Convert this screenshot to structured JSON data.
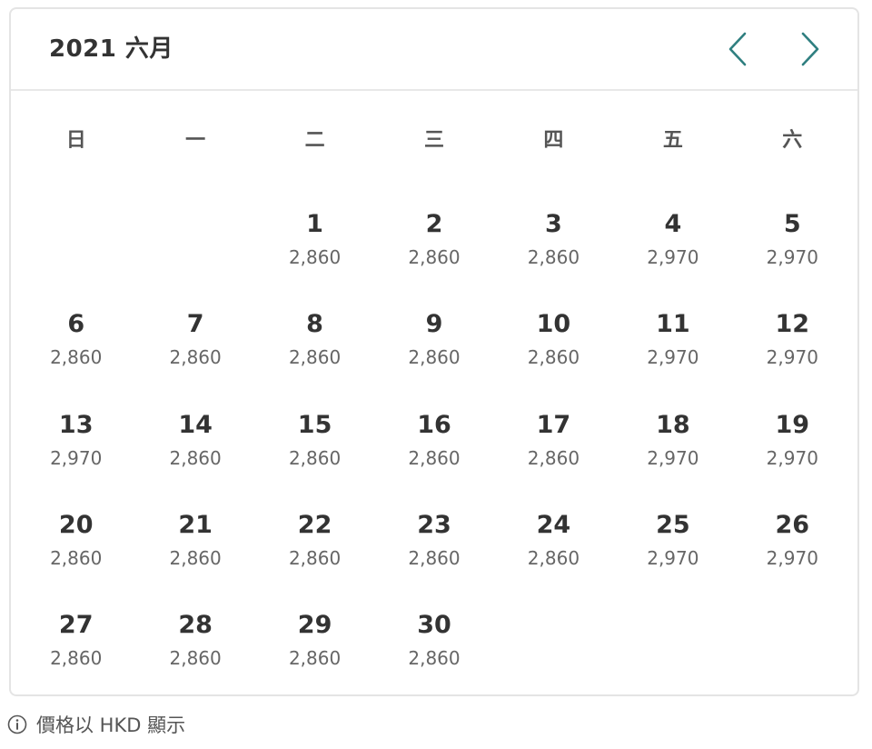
{
  "header": {
    "month_title": "2021 六月",
    "prev_icon": "chevron-left-icon",
    "next_icon": "chevron-right-icon",
    "accent_color": "#2f7f80"
  },
  "weekdays": [
    "日",
    "一",
    "二",
    "三",
    "四",
    "五",
    "六"
  ],
  "days": [
    {
      "day": "1",
      "price": "2,860"
    },
    {
      "day": "2",
      "price": "2,860"
    },
    {
      "day": "3",
      "price": "2,860"
    },
    {
      "day": "4",
      "price": "2,970"
    },
    {
      "day": "5",
      "price": "2,970"
    },
    {
      "day": "6",
      "price": "2,860"
    },
    {
      "day": "7",
      "price": "2,860"
    },
    {
      "day": "8",
      "price": "2,860"
    },
    {
      "day": "9",
      "price": "2,860"
    },
    {
      "day": "10",
      "price": "2,860"
    },
    {
      "day": "11",
      "price": "2,970"
    },
    {
      "day": "12",
      "price": "2,970"
    },
    {
      "day": "13",
      "price": "2,970"
    },
    {
      "day": "14",
      "price": "2,860"
    },
    {
      "day": "15",
      "price": "2,860"
    },
    {
      "day": "16",
      "price": "2,860"
    },
    {
      "day": "17",
      "price": "2,860"
    },
    {
      "day": "18",
      "price": "2,970"
    },
    {
      "day": "19",
      "price": "2,970"
    },
    {
      "day": "20",
      "price": "2,860"
    },
    {
      "day": "21",
      "price": "2,860"
    },
    {
      "day": "22",
      "price": "2,860"
    },
    {
      "day": "23",
      "price": "2,860"
    },
    {
      "day": "24",
      "price": "2,860"
    },
    {
      "day": "25",
      "price": "2,970"
    },
    {
      "day": "26",
      "price": "2,970"
    },
    {
      "day": "27",
      "price": "2,860"
    },
    {
      "day": "28",
      "price": "2,860"
    },
    {
      "day": "29",
      "price": "2,860"
    },
    {
      "day": "30",
      "price": "2,860"
    }
  ],
  "footer": {
    "icon": "info-icon",
    "note": "價格以 HKD 顯示"
  }
}
